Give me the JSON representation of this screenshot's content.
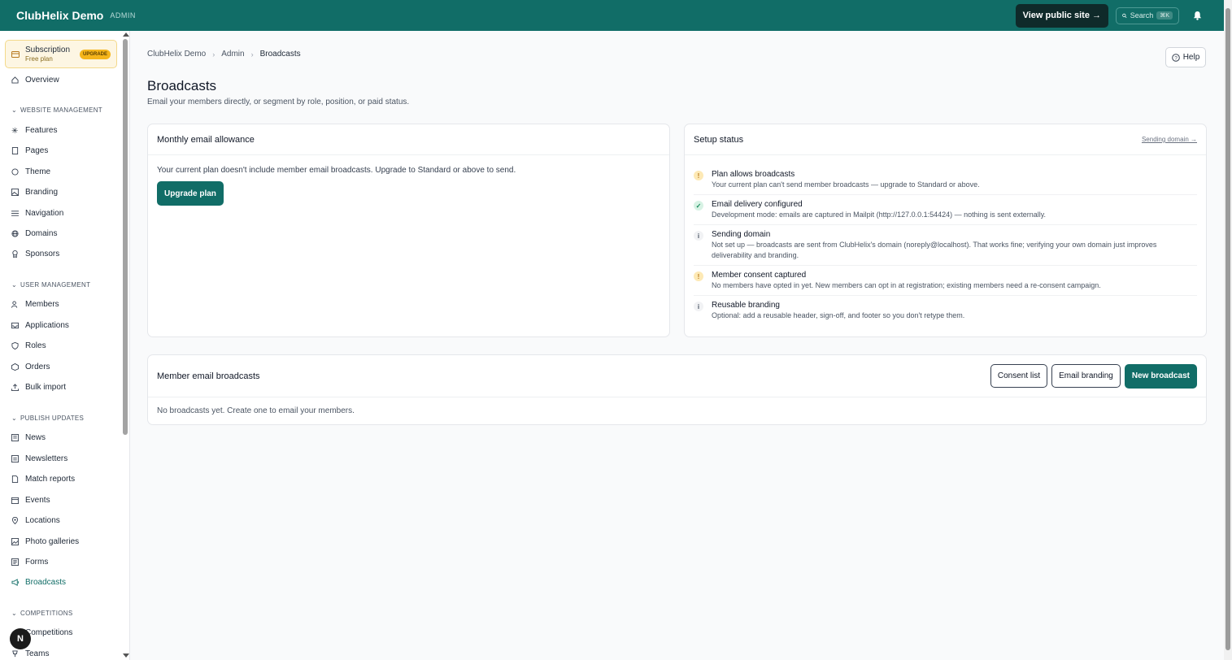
{
  "header": {
    "app_name": "ClubHelix Demo",
    "admin_label": "ADMIN",
    "view_site_label": "View public site →",
    "search_label": "Search",
    "search_shortcut": "⌘K"
  },
  "sidebar": {
    "subscription_title": "Subscription",
    "subscription_plan": "Free plan",
    "upgrade_label": "UPGRADE",
    "overview": "Overview",
    "sections": {
      "website": "WEBSITE MANAGEMENT",
      "users": "USER MANAGEMENT",
      "publish": "PUBLISH UPDATES",
      "competitions": "COMPETITIONS"
    },
    "website_items": [
      "Features",
      "Pages",
      "Theme",
      "Branding",
      "Navigation",
      "Domains",
      "Sponsors"
    ],
    "user_items": [
      "Members",
      "Applications",
      "Roles",
      "Orders",
      "Bulk import"
    ],
    "publish_items": [
      "News",
      "Newsletters",
      "Match reports",
      "Events",
      "Locations",
      "Photo galleries",
      "Forms",
      "Broadcasts"
    ],
    "competition_items": [
      "Competitions",
      "Teams"
    ],
    "fab_label": "N"
  },
  "breadcrumb": [
    "ClubHelix Demo",
    "Admin",
    "Broadcasts"
  ],
  "help_label": "Help",
  "page": {
    "title": "Broadcasts",
    "subtitle": "Email your members directly, or segment by role, position, or paid status."
  },
  "allowance": {
    "title": "Monthly email allowance",
    "message": "Your current plan doesn't include member email broadcasts. Upgrade to Standard or above to send.",
    "button": "Upgrade plan"
  },
  "setup": {
    "title": "Setup status",
    "link": "Sending domain →",
    "items": [
      {
        "status": "warn",
        "icon": "!",
        "title": "Plan allows broadcasts",
        "desc": "Your current plan can't send member broadcasts — upgrade to Standard or above."
      },
      {
        "status": "ok",
        "icon": "✓",
        "title": "Email delivery configured",
        "desc": "Development mode: emails are captured in Mailpit (http://127.0.0.1:54424) — nothing is sent externally."
      },
      {
        "status": "info",
        "icon": "i",
        "title": "Sending domain",
        "desc": "Not set up — broadcasts are sent from ClubHelix's domain (noreply@localhost). That works fine; verifying your own domain just improves deliverability and branding."
      },
      {
        "status": "warn",
        "icon": "!",
        "title": "Member consent captured",
        "desc": "No members have opted in yet. New members can opt in at registration; existing members need a re-consent campaign."
      },
      {
        "status": "info",
        "icon": "i",
        "title": "Reusable branding",
        "desc": "Optional: add a reusable header, sign-off, and footer so you don't retype them."
      }
    ]
  },
  "broadcasts": {
    "title": "Member email broadcasts",
    "consent_button": "Consent list",
    "branding_button": "Email branding",
    "new_button": "New broadcast",
    "empty": "No broadcasts yet. Create one to email your members."
  }
}
